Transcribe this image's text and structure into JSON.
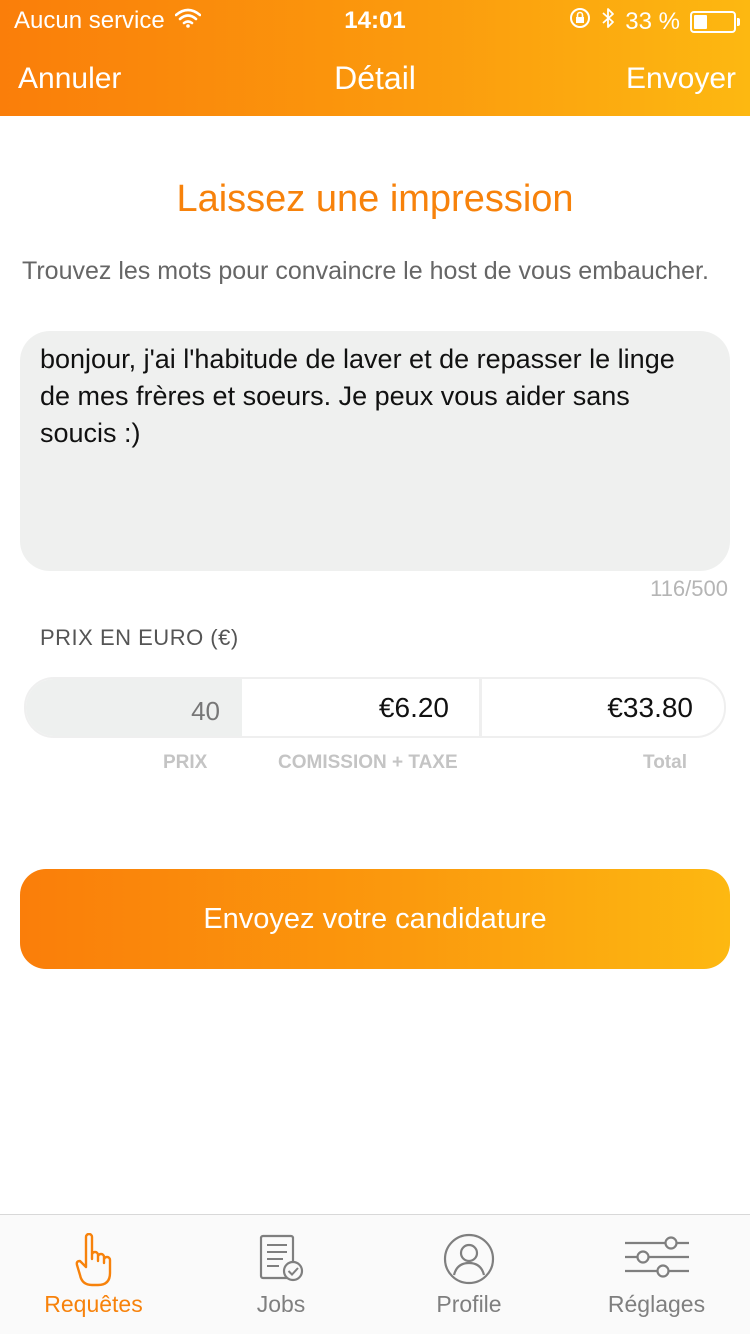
{
  "status_bar": {
    "carrier": "Aucun service",
    "time": "14:01",
    "battery": "33 %",
    "battery_level": 0.33
  },
  "nav": {
    "left": "Annuler",
    "title": "Détail",
    "right": "Envoyer"
  },
  "main": {
    "headline": "Laissez une impression",
    "subtext": "Trouvez les mots pour convaincre le host de vous embaucher.",
    "message": "bonjour, j'ai l'habitude de laver et de repasser le linge de mes frères et soeurs. Je peux vous aider sans soucis :)",
    "char_count": "116/500",
    "price_section_label": "PRIX EN EURO (€)",
    "price": "40",
    "commission": "€6.20",
    "total": "€33.80",
    "labels": {
      "price": "PRIX",
      "commission": "COMISSION + TAXE",
      "total": "Total"
    },
    "cta": "Envoyez votre candidature"
  },
  "tabs": [
    {
      "label": "Requêtes",
      "icon": "hand-pointing-icon",
      "active": true
    },
    {
      "label": "Jobs",
      "icon": "document-check-icon",
      "active": false
    },
    {
      "label": "Profile",
      "icon": "user-circle-icon",
      "active": false
    },
    {
      "label": "Réglages",
      "icon": "sliders-icon",
      "active": false
    }
  ],
  "colors": {
    "accent": "#f7820b",
    "gradient_start": "#fa7e0a",
    "gradient_end": "#fdb811"
  }
}
